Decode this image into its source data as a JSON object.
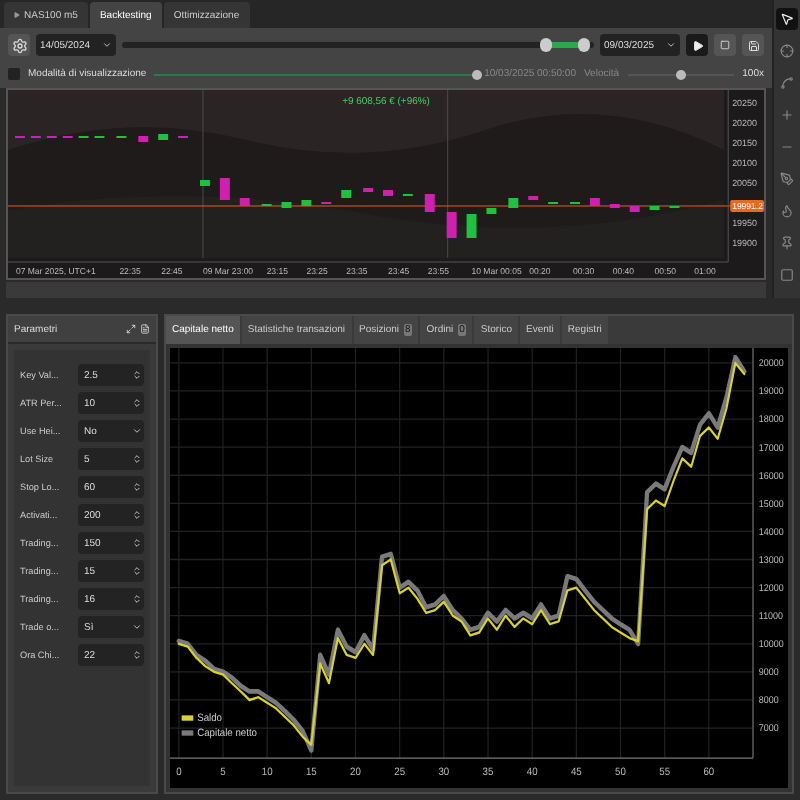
{
  "tabs": [
    {
      "label": "NAS100  m5",
      "selected": false,
      "kind": "symbol"
    },
    {
      "label": "Backtesting",
      "selected": true,
      "kind": "plain"
    },
    {
      "label": "Ottimizzazione",
      "selected": false,
      "kind": "plain"
    }
  ],
  "range": {
    "start_date": "14/05/2024",
    "end_date": "09/03/2025",
    "handles": [
      {
        "level": 0.9
      },
      {
        "level": 0.98
      }
    ]
  },
  "playback": {
    "label": "Modalità di visualizzazione",
    "checked": false,
    "level": 1,
    "timestamp": "10/03/2025 00:50:00",
    "speed_label": "Velocità",
    "speed_slider": {
      "level": 0.5
    },
    "speed": "100x"
  },
  "price_chart": {
    "profit": "+9 608,56 € (+96%)",
    "price_labels": [
      "20250",
      "20200",
      "20150",
      "20100",
      "20050",
      "19950",
      "19900"
    ],
    "current_price": "19991.2",
    "time_labels": [
      "07 Mar 2025, UTC+1",
      "22:35",
      "22:45",
      "09 Mar 23:00",
      "23:15",
      "23:25",
      "23:35",
      "23:45",
      "23:55",
      "10 Mar 00:05",
      "00:20",
      "00:30",
      "00:40",
      "00:50",
      "01:00"
    ]
  },
  "parameters": {
    "title": "Parametri",
    "items": [
      {
        "label": "Key Val...",
        "value": "2.5",
        "kind": "spin"
      },
      {
        "label": "ATR Per...",
        "value": "10",
        "kind": "spin"
      },
      {
        "label": "Use Hei...",
        "value": "No",
        "kind": "select"
      },
      {
        "label": "Lot Size",
        "value": "5",
        "kind": "spin"
      },
      {
        "label": "Stop Lo...",
        "value": "60",
        "kind": "spin"
      },
      {
        "label": "Activati...",
        "value": "200",
        "kind": "spin"
      },
      {
        "label": "Trading...",
        "value": "150",
        "kind": "spin"
      },
      {
        "label": "Trading...",
        "value": "15",
        "kind": "spin"
      },
      {
        "label": "Trading...",
        "value": "16",
        "kind": "spin"
      },
      {
        "label": "Trade o...",
        "value": "Sì",
        "kind": "select"
      },
      {
        "label": "Ora Chi...",
        "value": "22",
        "kind": "spin"
      }
    ]
  },
  "results_tabs": [
    {
      "label": "Capitale netto",
      "selected": true
    },
    {
      "label": "Statistiche transazioni",
      "selected": false
    },
    {
      "label": "Posizioni",
      "badge": "8",
      "selected": false
    },
    {
      "label": "Ordini",
      "badge": "0",
      "selected": false
    },
    {
      "label": "Storico",
      "selected": false
    },
    {
      "label": "Eventi",
      "selected": false
    },
    {
      "label": "Registri",
      "selected": false
    }
  ],
  "equity": {
    "chart_data": {
      "type": "line",
      "xlim": [
        -1,
        65
      ],
      "ylim": [
        5930,
        20530
      ],
      "grid": true,
      "legend": true,
      "xticks": [
        {
          "value": 0,
          "label": "0"
        },
        {
          "value": 5,
          "label": "5"
        },
        {
          "value": 10,
          "label": "10"
        },
        {
          "value": 15,
          "label": "15"
        },
        {
          "value": 20,
          "label": "20"
        },
        {
          "value": 25,
          "label": "25"
        },
        {
          "value": 30,
          "label": "30"
        },
        {
          "value": 35,
          "label": "35"
        },
        {
          "value": 40,
          "label": "40"
        },
        {
          "value": 45,
          "label": "45"
        },
        {
          "value": 50,
          "label": "50"
        },
        {
          "value": 55,
          "label": "55"
        },
        {
          "value": 60,
          "label": "60"
        }
      ],
      "yticks": [
        7000,
        8000,
        9000,
        10000,
        11000,
        12000,
        13000,
        14000,
        15000,
        16000,
        17000,
        18000,
        19000,
        20000
      ],
      "x": [
        0,
        1,
        2,
        3,
        4,
        5,
        6,
        7,
        8,
        9,
        10,
        11,
        12,
        13,
        14,
        15,
        16,
        17,
        18,
        19,
        20,
        21,
        22,
        23,
        24,
        25,
        26,
        27,
        28,
        29,
        30,
        31,
        32,
        33,
        34,
        35,
        36,
        37,
        38,
        39,
        40,
        41,
        42,
        43,
        44,
        45,
        46,
        47,
        48,
        49,
        50,
        51,
        52,
        53,
        54,
        55,
        56,
        57,
        58,
        59,
        60,
        61,
        62,
        63,
        64
      ],
      "series": [
        {
          "name": "Saldo",
          "color": "#d8d038",
          "values": [
            10000,
            9900,
            9500,
            9200,
            9000,
            8900,
            8600,
            8300,
            8000,
            8100,
            7900,
            7700,
            7400,
            7100,
            6700,
            6400,
            9300,
            8600,
            10200,
            9600,
            9500,
            10000,
            9600,
            12800,
            13000,
            11800,
            12000,
            11600,
            11100,
            11200,
            11500,
            11000,
            10800,
            10300,
            10400,
            10900,
            10500,
            11000,
            10600,
            10900,
            10700,
            11200,
            10700,
            10800,
            11900,
            12000,
            11600,
            11200,
            10900,
            10600,
            10400,
            10200,
            10100,
            14800,
            15100,
            14900,
            15800,
            16600,
            16300,
            17400,
            17700,
            17300,
            18400,
            20000,
            19600
          ]
        },
        {
          "name": "Capitale netto",
          "color": "#7a7a7a",
          "values": [
            10100,
            10000,
            9600,
            9400,
            9100,
            9000,
            8800,
            8500,
            8300,
            8300,
            8100,
            7900,
            7600,
            7300,
            6900,
            6200,
            9600,
            8900,
            10500,
            9900,
            9700,
            10300,
            9800,
            13100,
            13200,
            12000,
            12200,
            11900,
            11300,
            11400,
            11700,
            11200,
            10900,
            10500,
            10600,
            11100,
            10800,
            11200,
            10900,
            11100,
            10900,
            11400,
            10900,
            11000,
            12400,
            12300,
            11900,
            11500,
            11200,
            10900,
            10700,
            10500,
            10000,
            15400,
            15700,
            15500,
            16300,
            17000,
            16800,
            17800,
            18200,
            17700,
            18800,
            20200,
            19700
          ]
        }
      ]
    }
  }
}
